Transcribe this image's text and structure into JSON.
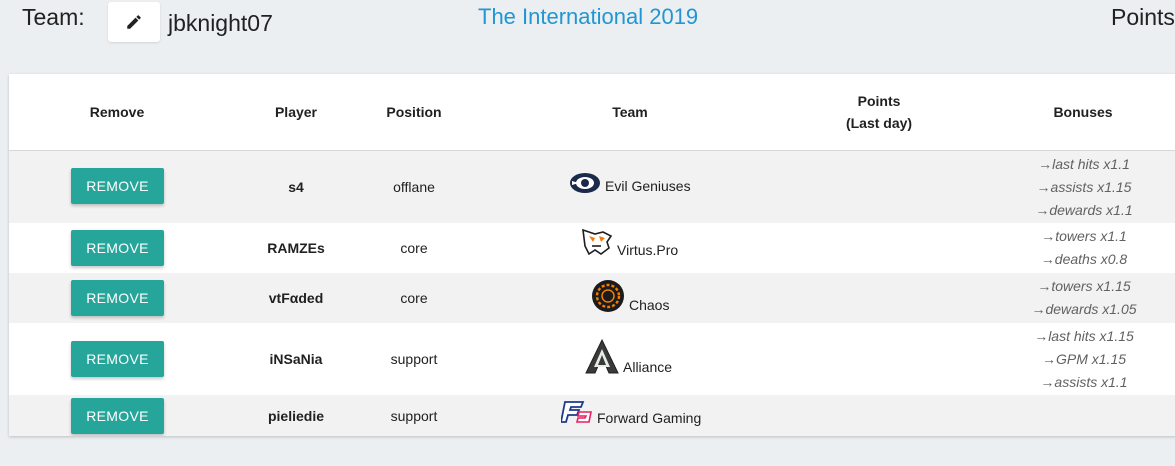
{
  "header": {
    "team_label": "Team:",
    "team_name": "jbknight07",
    "tournament": "The International 2019",
    "points_label": "Points:",
    "edit_icon": "pencil-icon"
  },
  "table": {
    "columns": {
      "remove": "Remove",
      "player": "Player",
      "position": "Position",
      "team": "Team",
      "points_line1": "Points",
      "points_line2": "(Last day)",
      "bonuses": "Bonuses"
    },
    "remove_label": "REMOVE",
    "rows": [
      {
        "player": "s4",
        "position": "offlane",
        "team": "Evil Geniuses",
        "team_icon": "evil-geniuses-logo",
        "bonuses": [
          "→last hits x1.1",
          "→assists x1.15",
          "→dewards x1.1"
        ]
      },
      {
        "player": "RAMZEs",
        "position": "core",
        "team": "Virtus.Pro",
        "team_icon": "virtus-pro-logo",
        "bonuses": [
          "→towers x1.1",
          "→deaths x0.8"
        ]
      },
      {
        "player": "vtFαded",
        "position": "core",
        "team": "Chaos",
        "team_icon": "chaos-logo",
        "bonuses": [
          "→towers x1.15",
          "→dewards x1.05"
        ]
      },
      {
        "player": "iNSaNia",
        "position": "support",
        "team": "Alliance",
        "team_icon": "alliance-logo",
        "bonuses": [
          "→last hits x1.15",
          "→GPM x1.15",
          "→assists x1.1"
        ]
      },
      {
        "player": "pieliedie",
        "position": "support",
        "team": "Forward Gaming",
        "team_icon": "forward-gaming-logo",
        "bonuses": []
      }
    ]
  },
  "colors": {
    "accent": "#26a69a",
    "link": "#2196d3",
    "background": "#eceff1"
  }
}
